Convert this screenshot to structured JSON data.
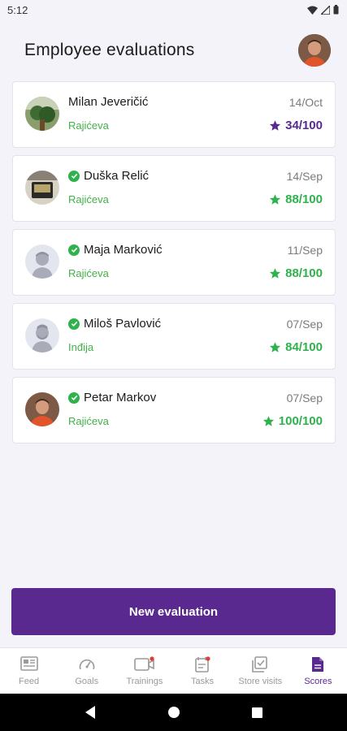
{
  "status_bar": {
    "time": "5:12"
  },
  "header": {
    "title": "Employee evaluations"
  },
  "evaluations": [
    {
      "name": "Milan Jeveričić",
      "location": "Rajićeva",
      "date": "14/Oct",
      "score": "34/100",
      "verified": false,
      "score_color": "#5a2990"
    },
    {
      "name": "Duška Relić",
      "location": "Rajićeva",
      "date": "14/Sep",
      "score": "88/100",
      "verified": true,
      "score_color": "#2eb24c"
    },
    {
      "name": "Maja Marković",
      "location": "Rajićeva",
      "date": "11/Sep",
      "score": "88/100",
      "verified": true,
      "score_color": "#2eb24c"
    },
    {
      "name": "Miloš Pavlović",
      "location": "Inđija",
      "date": "07/Sep",
      "score": "84/100",
      "verified": true,
      "score_color": "#2eb24c"
    },
    {
      "name": "Petar Markov",
      "location": "Rajićeva",
      "date": "07/Sep",
      "score": "100/100",
      "verified": true,
      "score_color": "#2eb24c"
    }
  ],
  "cta": {
    "label": "New evaluation"
  },
  "bottom_nav": {
    "items": [
      {
        "label": "Feed",
        "icon": "feed-icon"
      },
      {
        "label": "Goals",
        "icon": "gauge-icon"
      },
      {
        "label": "Trainings",
        "icon": "video-icon"
      },
      {
        "label": "Tasks",
        "icon": "calendar-icon"
      },
      {
        "label": "Store visits",
        "icon": "checklist-icon"
      },
      {
        "label": "Scores",
        "icon": "document-icon",
        "active": true
      }
    ]
  },
  "colors": {
    "accent": "#5a2990",
    "success": "#2eb24c",
    "background": "#f4f3f9"
  }
}
